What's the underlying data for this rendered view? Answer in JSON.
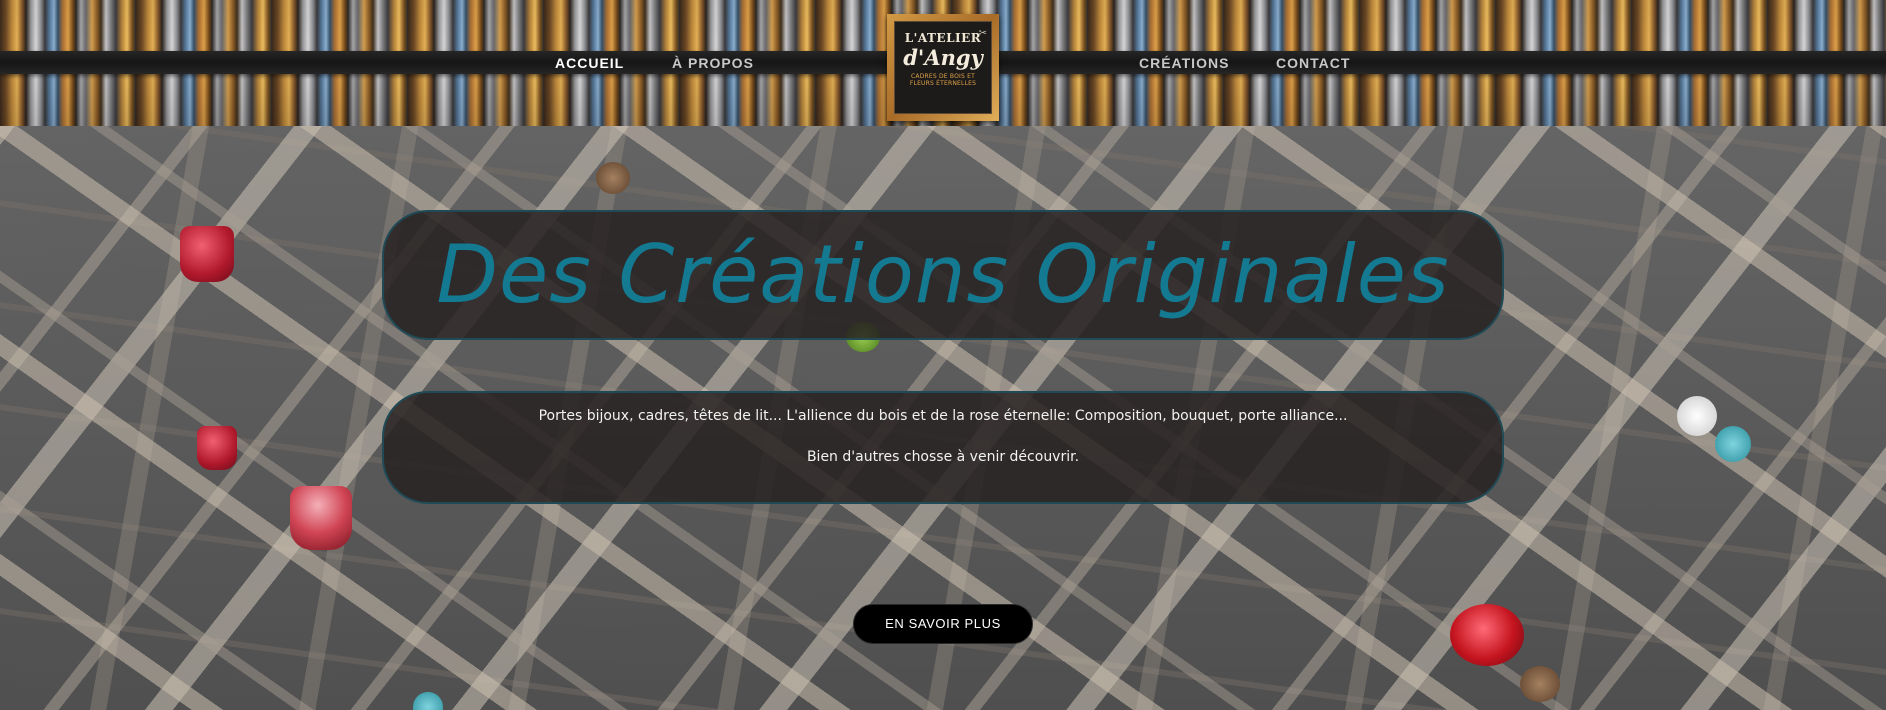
{
  "nav": {
    "items": [
      {
        "label": "ACCUEIL",
        "active": true
      },
      {
        "label": "À PROPOS",
        "active": false
      },
      {
        "label": "CRÉATIONS",
        "active": false
      },
      {
        "label": "CONTACT",
        "active": false
      }
    ]
  },
  "logo": {
    "line1": "L'ATELIER",
    "line2": "d'Angy",
    "line3": "CADRES DE BOIS ET FLEURS ÉTERNELLES"
  },
  "hero": {
    "title": "Des Créations Originales",
    "paragraph1": "Portes bijoux, cadres, têtes de lit... L'allience du bois et de la rose éternelle: Composition, bouquet, porte alliance...",
    "paragraph2": "Bien d'autres chosse à venir découvrir.",
    "cta_label": "EN SAVOIR PLUS"
  },
  "colors": {
    "title": "#137a92",
    "panel": "#262222",
    "panel_border": "#1f4a56",
    "cta_background": "#000000",
    "nav_band": "#1c1c1c"
  }
}
